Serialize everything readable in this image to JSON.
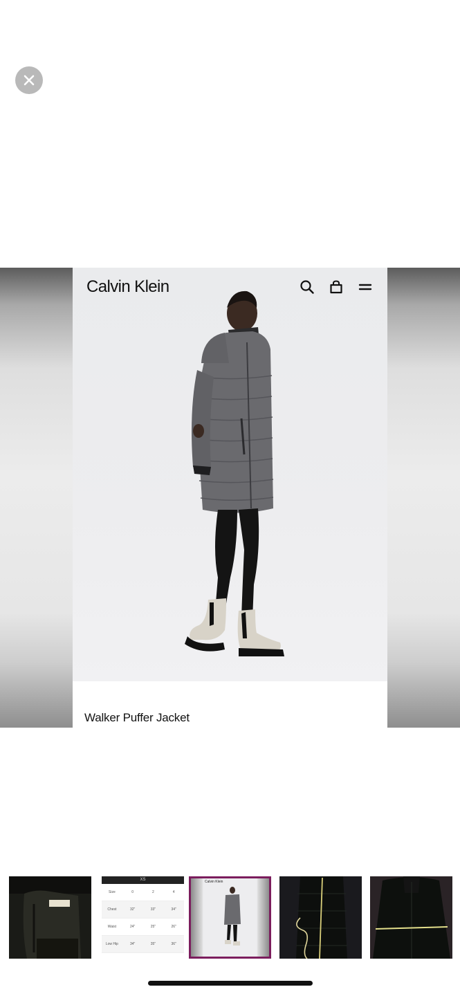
{
  "viewer": {
    "brand": "Calvin Klein",
    "product_title": "Walker Puffer Jacket"
  },
  "size_chart": {
    "header": "XS",
    "columns": [
      "0",
      "2",
      "4"
    ],
    "rows": [
      {
        "label": "Size",
        "values": [
          "0",
          "2",
          "4"
        ]
      },
      {
        "label": "Chest",
        "values": [
          "32\"",
          "33\"",
          "34\""
        ]
      },
      {
        "label": "Waist",
        "values": [
          "24\"",
          "25\"",
          "26\""
        ]
      },
      {
        "label": "Low Hip",
        "values": [
          "34\"",
          "35\"",
          "36\""
        ]
      }
    ]
  },
  "thumbnails": {
    "count": 5,
    "selected_index": 2,
    "selected_border_color": "#7b1d5d",
    "selected_mini_brand": "Calvin Klein"
  },
  "icons": {
    "close": "close-icon",
    "search": "search-icon",
    "bag": "shopping-bag-icon",
    "menu": "hamburger-menu-icon"
  }
}
